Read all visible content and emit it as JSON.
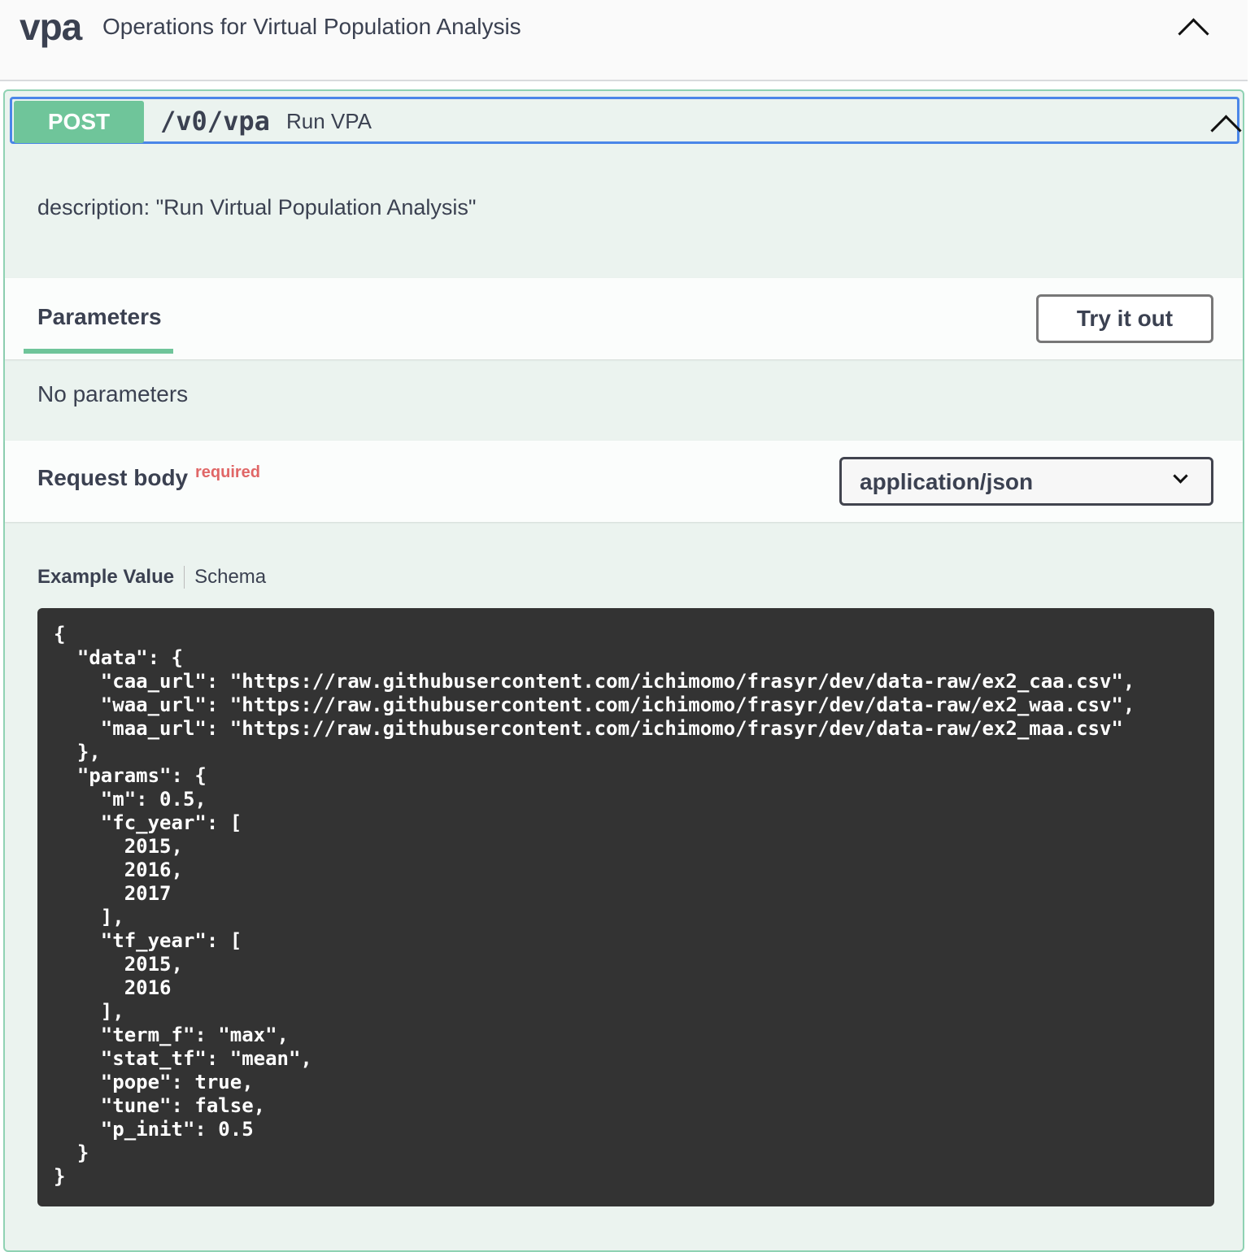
{
  "tag": {
    "name": "vpa",
    "description": "Operations for Virtual Population Analysis"
  },
  "operation": {
    "method": "POST",
    "path": "/v0/vpa",
    "summary": "Run VPA",
    "description": "description: \"Run Virtual Population Analysis\""
  },
  "parameters": {
    "tab_label": "Parameters",
    "try_it_out": "Try it out",
    "empty_text": "No parameters"
  },
  "request_body": {
    "title": "Request body",
    "required_label": "required",
    "content_type": "application/json",
    "tabs": [
      "Example Value",
      "Schema"
    ],
    "example": "{\n  \"data\": {\n    \"caa_url\": \"https://raw.githubusercontent.com/ichimomo/frasyr/dev/data-raw/ex2_caa.csv\",\n    \"waa_url\": \"https://raw.githubusercontent.com/ichimomo/frasyr/dev/data-raw/ex2_waa.csv\",\n    \"maa_url\": \"https://raw.githubusercontent.com/ichimomo/frasyr/dev/data-raw/ex2_maa.csv\"\n  },\n  \"params\": {\n    \"m\": 0.5,\n    \"fc_year\": [\n      2015,\n      2016,\n      2017\n    ],\n    \"tf_year\": [\n      2015,\n      2016\n    ],\n    \"term_f\": \"max\",\n    \"stat_tf\": \"mean\",\n    \"pope\": true,\n    \"tune\": false,\n    \"p_init\": 0.5\n  }\n}"
  },
  "icons": {
    "tag_toggle": "chevron-up-icon",
    "op_toggle": "chevron-up-icon",
    "select_arrow": "chevron-down-icon"
  },
  "colors": {
    "post_green": "#6fc59a",
    "opblock_bg": "#ebf3ef",
    "opblock_border": "#8fd2b3",
    "focus_outline": "#4a86e8",
    "required_red": "#e06767",
    "code_bg": "#333333"
  }
}
